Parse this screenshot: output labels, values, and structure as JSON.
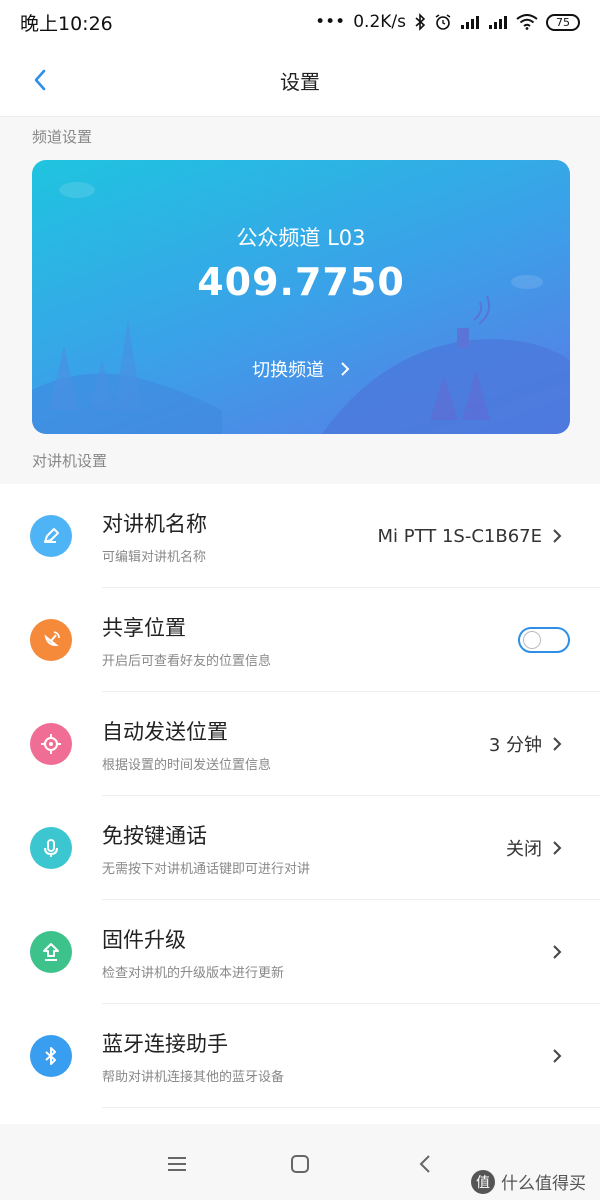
{
  "status_bar": {
    "time": "晚上10:26",
    "dots": "•••",
    "speed": "0.2K/s",
    "battery": "75"
  },
  "header": {
    "title": "设置"
  },
  "sections": {
    "channel": "频道设置",
    "radio": "对讲机设置"
  },
  "channel_card": {
    "channel_name": "公众频道 L03",
    "frequency": "409.7750",
    "switch_label": "切换频道"
  },
  "settings": [
    {
      "name": "对讲机名称",
      "desc": "可编辑对讲机名称",
      "value": "Mi PTT 1S-C1B67E",
      "icon": "pen-icon",
      "color": "#4fb4f5"
    },
    {
      "name": "共享位置",
      "desc": "开启后可查看好友的位置信息",
      "toggle": false,
      "icon": "satellite-icon",
      "color": "#f58a3a"
    },
    {
      "name": "自动发送位置",
      "desc": "根据设置的时间发送位置信息",
      "value": "3 分钟",
      "icon": "target-icon",
      "color": "#f06e96"
    },
    {
      "name": "免按键通话",
      "desc": "无需按下对讲机通话键即可进行对讲",
      "value": "关闭",
      "icon": "microphone-icon",
      "color": "#3cc6cf"
    },
    {
      "name": "固件升级",
      "desc": "检查对讲机的升级版本进行更新",
      "icon": "upgrade-icon",
      "color": "#3ec28b"
    },
    {
      "name": "蓝牙连接助手",
      "desc": "帮助对讲机连接其他的蓝牙设备",
      "icon": "bluetooth-icon",
      "color": "#3a9ef0"
    }
  ],
  "watermark": {
    "text": "什么值得买",
    "badge": "值"
  }
}
